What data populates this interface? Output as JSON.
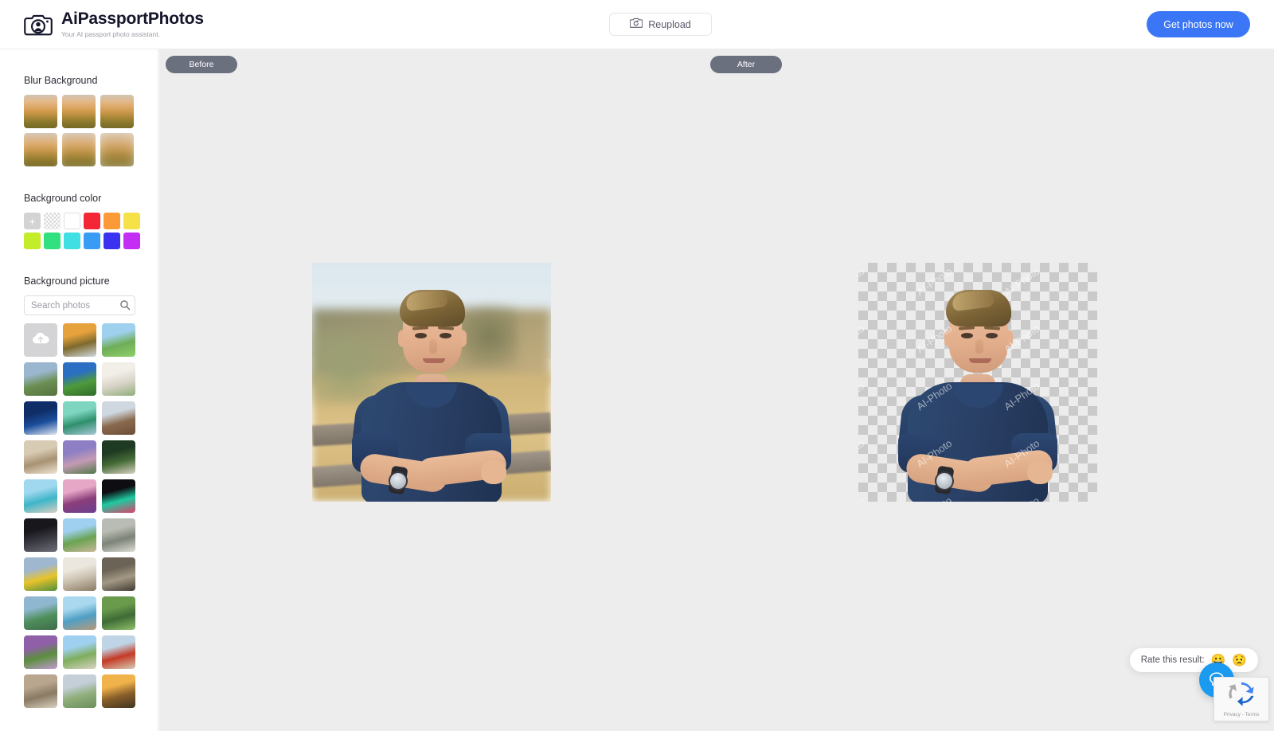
{
  "header": {
    "brand_name": "AiPassportPhotos",
    "brand_tagline": "Your AI passport photo assistant.",
    "logo_icon": "camera-portrait-icon",
    "reupload_label": "Reupload",
    "reupload_icon": "camera-refresh-icon",
    "cta_label": "Get photos now",
    "accent_color": "#3b76f6"
  },
  "sidebar": {
    "blur_section": {
      "title": "Blur Background",
      "thumbs": [
        {
          "name": "blur-level-1",
          "blur": "1.2px"
        },
        {
          "name": "blur-level-2",
          "blur": "2.5px"
        },
        {
          "name": "blur-level-3",
          "blur": "4px"
        },
        {
          "name": "blur-level-4",
          "blur": "6px"
        },
        {
          "name": "blur-level-5",
          "blur": "8px"
        },
        {
          "name": "blur-level-6",
          "blur": "10px"
        }
      ]
    },
    "color_section": {
      "title": "Background color",
      "add_label": "+",
      "swatches": [
        {
          "name": "add-custom-color",
          "type": "add",
          "color": "#d3d3d5"
        },
        {
          "name": "transparent",
          "type": "transparent",
          "color": "transparent"
        },
        {
          "name": "white",
          "type": "white",
          "color": "#ffffff"
        },
        {
          "name": "red",
          "type": "solid",
          "color": "#f32735"
        },
        {
          "name": "orange",
          "type": "solid",
          "color": "#fb9a36"
        },
        {
          "name": "yellow",
          "type": "solid",
          "color": "#f7e148"
        },
        {
          "name": "lime",
          "type": "solid",
          "color": "#c3ec2a"
        },
        {
          "name": "green",
          "type": "solid",
          "color": "#31e07f"
        },
        {
          "name": "cyan",
          "type": "solid",
          "color": "#3fdfe4"
        },
        {
          "name": "blue",
          "type": "solid",
          "color": "#3a9bf4"
        },
        {
          "name": "indigo",
          "type": "solid",
          "color": "#3b31f0"
        },
        {
          "name": "magenta",
          "type": "solid",
          "color": "#c32df4"
        }
      ]
    },
    "picture_section": {
      "title": "Background picture",
      "search_placeholder": "Search photos",
      "search_value": "",
      "search_icon": "search-icon",
      "upload_tile": {
        "name": "upload-photo-tile",
        "icon": "cloud-upload-icon"
      },
      "photos": [
        {
          "name": "photo-autumn-city",
          "c1": "#e6a23c",
          "c2": "#7d6a2e",
          "c3": "#cfd8e0"
        },
        {
          "name": "photo-lone-tree-field",
          "c1": "#9fd1ef",
          "c2": "#6fae58",
          "c3": "#8ecf6a"
        },
        {
          "name": "photo-mountain-meadow",
          "c1": "#9bb7cf",
          "c2": "#6b8f52",
          "c3": "#54713e"
        },
        {
          "name": "photo-green-golf-hills",
          "c1": "#2a6fc2",
          "c2": "#4f9a3c",
          "c3": "#2f6b2a"
        },
        {
          "name": "photo-white-room-plants",
          "c1": "#f2efe9",
          "c2": "#d9d4c8",
          "c3": "#8fae7a"
        },
        {
          "name": "photo-full-moon-night",
          "c1": "#0f2d66",
          "c2": "#1b4e9c",
          "c3": "#dfe6f2"
        },
        {
          "name": "photo-green-car-tree",
          "c1": "#7fd6c0",
          "c2": "#2f8f6d",
          "c3": "#a8c8d8"
        },
        {
          "name": "photo-desert-plain",
          "c1": "#cfd8e0",
          "c2": "#8a6a4e",
          "c3": "#6b4f38"
        },
        {
          "name": "photo-curtain-window",
          "c1": "#d8cbb4",
          "c2": "#a89273",
          "c3": "#efe6d4"
        },
        {
          "name": "photo-purple-sunset-hills",
          "c1": "#8e7fc4",
          "c2": "#c49ab4",
          "c3": "#4e7a46"
        },
        {
          "name": "photo-chair-under-tree",
          "c1": "#1f3a22",
          "c2": "#456b36",
          "c3": "#d8d2c2"
        },
        {
          "name": "photo-beach-pier",
          "c1": "#9fd8ef",
          "c2": "#3fb5c9",
          "c3": "#d8cfc0"
        },
        {
          "name": "photo-tulip-sunset-field",
          "c1": "#e6a6c6",
          "c2": "#8b3f7a",
          "c3": "#6b3f8f"
        },
        {
          "name": "photo-ferris-wheel-night",
          "c1": "#0d0d12",
          "c2": "#1fc9a0",
          "c3": "#e0406a"
        },
        {
          "name": "photo-chalkboard-formula",
          "c1": "#17171c",
          "c2": "#3a3a42",
          "c3": "#6e6e78"
        },
        {
          "name": "photo-park-pathway",
          "c1": "#9fd0ef",
          "c2": "#6aa352",
          "c3": "#c9b79a"
        },
        {
          "name": "photo-birch-forest",
          "c1": "#b9bcb4",
          "c2": "#7d8378",
          "c3": "#dcded6"
        },
        {
          "name": "photo-yellow-tulips-mountain",
          "c1": "#9fb7cf",
          "c2": "#e8c32a",
          "c3": "#4f8f3c"
        },
        {
          "name": "photo-white-corridor",
          "c1": "#ece7de",
          "c2": "#c9bfae",
          "c3": "#8a7a63"
        },
        {
          "name": "photo-stone-columns",
          "c1": "#6b6356",
          "c2": "#a39884",
          "c3": "#3f3a31"
        },
        {
          "name": "photo-lake-rocks-green",
          "c1": "#8fb7cf",
          "c2": "#4f8f5c",
          "c3": "#3f6b4a"
        },
        {
          "name": "photo-sea-wooden-pier",
          "c1": "#a9d8ef",
          "c2": "#4f9fc4",
          "c3": "#b79a7a"
        },
        {
          "name": "photo-green-valley-hills",
          "c1": "#6a9a4c",
          "c2": "#3f6b35",
          "c3": "#8fbf6a"
        },
        {
          "name": "photo-lavender-path",
          "c1": "#8f5fa8",
          "c2": "#5a8f3c",
          "c3": "#c49ad4"
        },
        {
          "name": "photo-grass-walkway",
          "c1": "#9fd0ef",
          "c2": "#7fae5c",
          "c3": "#d8d2c4"
        },
        {
          "name": "photo-red-building-town",
          "c1": "#bfd4e4",
          "c2": "#c43a26",
          "c3": "#d8cbb4"
        },
        {
          "name": "photo-pisa-tower",
          "c1": "#b8a68f",
          "c2": "#8a7a63",
          "c3": "#d8cfc0"
        },
        {
          "name": "photo-cloudy-field",
          "c1": "#c4cfd8",
          "c2": "#8fae7a",
          "c3": "#6b8f5c"
        },
        {
          "name": "photo-sunset-ridge",
          "c1": "#f0b24a",
          "c2": "#8a5f2a",
          "c3": "#3f3420"
        }
      ]
    }
  },
  "canvas": {
    "before_label": "Before",
    "after_label": "After",
    "watermark_text": "AI-Photo",
    "background_color": "#ededed",
    "pill_color": "#6b707f"
  },
  "widgets": {
    "rate_label": "Rate this result:",
    "emoji_happy": "😀",
    "emoji_sad": "😟",
    "chat_icon": "chat-bubble-icon",
    "recaptcha_terms": "Privacy - Terms",
    "recaptcha_icon": "recaptcha-icon"
  }
}
